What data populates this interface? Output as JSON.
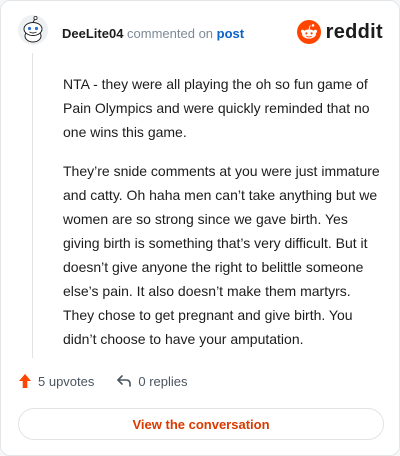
{
  "comment": {
    "username": "DeeLite04",
    "action_text": "commented on",
    "post_link_label": "post",
    "paragraphs": [
      "NTA - they were all playing the oh so fun game of Pain Olympics and were quickly reminded that no one wins this game.",
      "They’re snide comments at you were just immature and catty. Oh haha men can’t take anything but we women are so strong since we gave birth. Yes giving birth is something that’s very difficult. But it doesn’t give anyone the right to belittle someone else’s pain. It also doesn’t make them martyrs. They chose to get pregnant and give birth. You didn’t choose to have your amputation."
    ]
  },
  "brand": {
    "wordmark": "reddit",
    "color": "#ff4500"
  },
  "stats": {
    "upvotes_label": "5 upvotes",
    "replies_label": "0 replies"
  },
  "cta": {
    "label": "View the conversation",
    "color": "#d93a00"
  },
  "icons": {
    "upvote": "upvote-arrow-icon",
    "reply": "reply-arrow-icon",
    "logo": "reddit-alien-icon",
    "avatar": "snoo-avatar-icon"
  }
}
